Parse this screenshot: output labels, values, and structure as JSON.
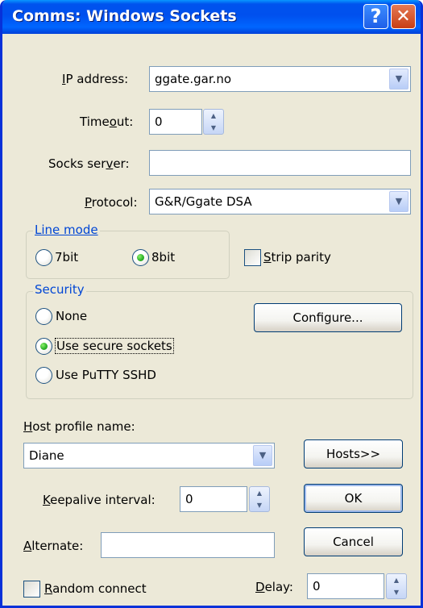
{
  "window": {
    "title": "Comms: Windows Sockets",
    "help_glyph": "?",
    "close_glyph": "✕"
  },
  "ip_address": {
    "pre": "",
    "u": "I",
    "post": "P address:",
    "value": "ggate.gar.no"
  },
  "timeout": {
    "pre": "Time",
    "u": "o",
    "post": "ut:",
    "value": "0"
  },
  "socks_server": {
    "pre": "Socks ser",
    "u": "v",
    "post": "er:",
    "value": ""
  },
  "protocol": {
    "pre": "",
    "u": "P",
    "post": "rotocol:",
    "value": "G&R/Ggate DSA"
  },
  "line_mode": {
    "title": "Line mode",
    "opt_7bit": "7bit",
    "opt_8bit": "8bit",
    "selected": "8bit"
  },
  "strip_parity": {
    "pre": "",
    "u": "S",
    "post": "trip parity",
    "checked": false
  },
  "security": {
    "title": "Security",
    "opt_none": "None",
    "opt_secure": "Use secure sockets",
    "opt_putty": "Use PuTTY SSHD",
    "selected": "Use secure sockets",
    "configure_label": "Configure..."
  },
  "host_profile": {
    "pre": "",
    "u": "H",
    "post": "ost profile name:",
    "value": "Diane",
    "hosts_label": "Hosts>>"
  },
  "keepalive": {
    "pre": "",
    "u": "K",
    "post": "eepalive interval:",
    "value": "0"
  },
  "ok_label": "OK",
  "alternate": {
    "pre": "",
    "u": "A",
    "post": "lternate:",
    "value": ""
  },
  "cancel_label": "Cancel",
  "random_connect": {
    "pre": "",
    "u": "R",
    "post": "andom connect",
    "checked": false
  },
  "delay": {
    "pre": "",
    "u": "D",
    "post": "elay:",
    "value": "0"
  },
  "icons": {
    "dropdown": "▼",
    "spin_up": "▲",
    "spin_down": "▼"
  },
  "colors": {
    "title_bar": "#0054e3",
    "group_title": "#0046d5",
    "dialog_bg": "#ece9d8"
  }
}
